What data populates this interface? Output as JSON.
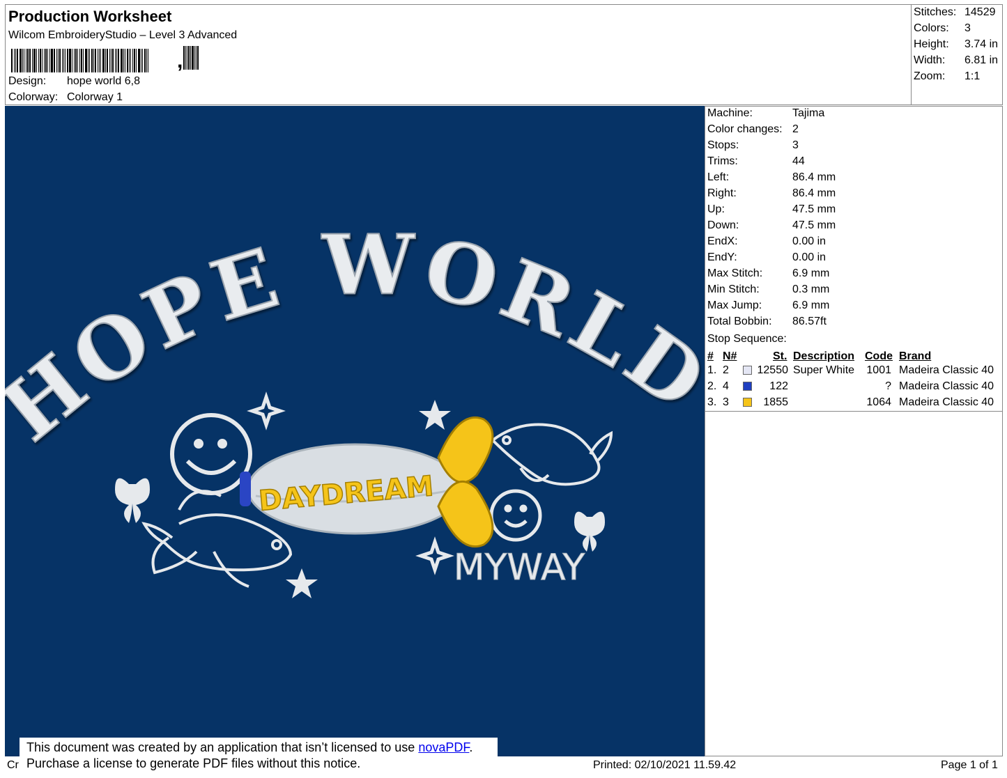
{
  "header": {
    "title": "Production Worksheet",
    "subtitle": "Wilcom EmbroideryStudio – Level 3 Advanced",
    "design_label": "Design:",
    "design_value": "hope world 6,8",
    "colorway_label": "Colorway:",
    "colorway_value": "Colorway 1",
    "barcode_comma": ","
  },
  "stats": [
    {
      "label": "Stitches:",
      "value": "14529"
    },
    {
      "label": "Colors:",
      "value": "3"
    },
    {
      "label": "Height:",
      "value": "3.74 in"
    },
    {
      "label": "Width:",
      "value": "6.81 in"
    },
    {
      "label": "Zoom:",
      "value": "1:1"
    }
  ],
  "properties": [
    {
      "label": "Machine:",
      "value": "Tajima"
    },
    {
      "label": "Color changes:",
      "value": "2"
    },
    {
      "label": "Stops:",
      "value": "3"
    },
    {
      "label": "Trims:",
      "value": "44"
    },
    {
      "label": "Left:",
      "value": "86.4 mm"
    },
    {
      "label": "Right:",
      "value": "86.4 mm"
    },
    {
      "label": "Up:",
      "value": "47.5 mm"
    },
    {
      "label": "Down:",
      "value": "47.5 mm"
    },
    {
      "label": "EndX:",
      "value": "0.00 in"
    },
    {
      "label": "EndY:",
      "value": "0.00 in"
    },
    {
      "label": "Max Stitch:",
      "value": "6.9 mm"
    },
    {
      "label": "Min Stitch:",
      "value": "0.3 mm"
    },
    {
      "label": "Max Jump:",
      "value": "6.9 mm"
    },
    {
      "label": "Total Bobbin:",
      "value": "86.57ft"
    }
  ],
  "stop_sequence": {
    "label": "Stop Sequence:",
    "headers": {
      "num": "#",
      "n": "N#",
      "st": "St.",
      "description": "Description",
      "code": "Code",
      "brand": "Brand"
    },
    "rows": [
      {
        "num": "1.",
        "n": "2",
        "color": "#e4e6f4",
        "st": "12550",
        "description": "Super White",
        "code": "1001",
        "brand": "Madeira Classic 40"
      },
      {
        "num": "2.",
        "n": "4",
        "color": "#1f3fc0",
        "st": "122",
        "description": "",
        "code": "?",
        "brand": "Madeira Classic 40"
      },
      {
        "num": "3.",
        "n": "3",
        "color": "#f5c419",
        "st": "1855",
        "description": "",
        "code": "1064",
        "brand": "Madeira Classic 40"
      }
    ]
  },
  "design": {
    "background": "#063366",
    "arched_text": "HOPE WORLD",
    "capsule_text": "DAYDREAM",
    "bottom_text": "MYWAY"
  },
  "footer": {
    "left_fragment": "Cr",
    "printed": "Printed: 02/10/2021 11.59.42",
    "page": "Page 1 of 1"
  },
  "notice": {
    "line1_prefix": "This document was created by an application that isn’t licensed to use ",
    "link": "novaPDF",
    "line1_suffix": ".",
    "line2": "Purchase a license to generate PDF files without this notice."
  }
}
